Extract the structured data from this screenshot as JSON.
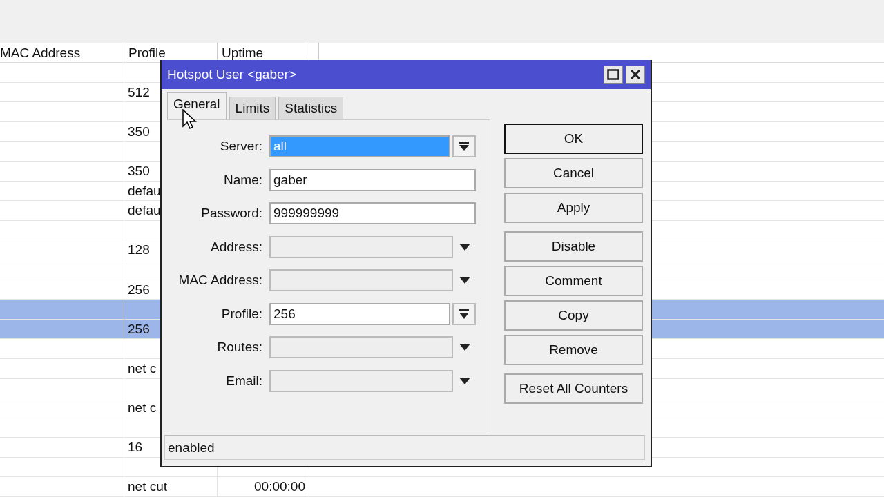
{
  "table": {
    "columns": [
      "MAC Address",
      "Profile",
      "Uptime"
    ],
    "rows": [
      {
        "selected": false
      },
      {
        "profile": "512",
        "selected": false
      },
      {
        "selected": false
      },
      {
        "profile": "350",
        "selected": false
      },
      {
        "selected": false
      },
      {
        "profile": "350",
        "selected": false
      },
      {
        "profile": "defau",
        "selected": false
      },
      {
        "profile": "defau",
        "selected": false
      },
      {
        "selected": false
      },
      {
        "profile": "128",
        "selected": false
      },
      {
        "selected": false
      },
      {
        "profile": "256",
        "selected": false
      },
      {
        "selected": true
      },
      {
        "profile": "256",
        "selected": true
      },
      {
        "selected": false
      },
      {
        "profile": "net c",
        "selected": false
      },
      {
        "selected": false
      },
      {
        "profile": "net c",
        "selected": false
      },
      {
        "selected": false
      },
      {
        "profile": "16",
        "selected": false
      },
      {
        "selected": false
      },
      {
        "profile": "net cut",
        "uptime": "00:00:00",
        "selected": false
      }
    ]
  },
  "dialog": {
    "title": "Hotspot User <gaber>",
    "tabs": [
      {
        "label": "General",
        "selected": true
      },
      {
        "label": "Limits",
        "selected": false
      },
      {
        "label": "Statistics",
        "selected": false
      }
    ],
    "fields": [
      {
        "label": "Server:",
        "value": "all",
        "kind": "select",
        "highlighted": true
      },
      {
        "label": "Name:",
        "value": "gaber",
        "kind": "text",
        "highlighted": false
      },
      {
        "label": "Password:",
        "value": "999999999",
        "kind": "text",
        "highlighted": false
      },
      {
        "label": "Address:",
        "kind": "optional",
        "highlighted": false
      },
      {
        "label": "MAC Address:",
        "kind": "optional",
        "highlighted": false
      },
      {
        "label": "Profile:",
        "value": "256",
        "kind": "select",
        "highlighted": false
      },
      {
        "label": "Routes:",
        "kind": "optional",
        "highlighted": false
      },
      {
        "label": "Email:",
        "kind": "optional",
        "highlighted": false
      }
    ],
    "button_groups": [
      {
        "buttons": [
          {
            "label": "OK",
            "default": true
          },
          {
            "label": "Cancel",
            "default": false
          },
          {
            "label": "Apply",
            "default": false
          }
        ]
      },
      {
        "buttons": [
          {
            "label": "Disable",
            "default": false
          },
          {
            "label": "Comment",
            "default": false
          },
          {
            "label": "Copy",
            "default": false
          },
          {
            "label": "Remove",
            "default": false
          }
        ]
      },
      {
        "buttons": [
          {
            "label": "Reset All Counters",
            "default": false
          }
        ]
      }
    ],
    "status": "enabled"
  }
}
